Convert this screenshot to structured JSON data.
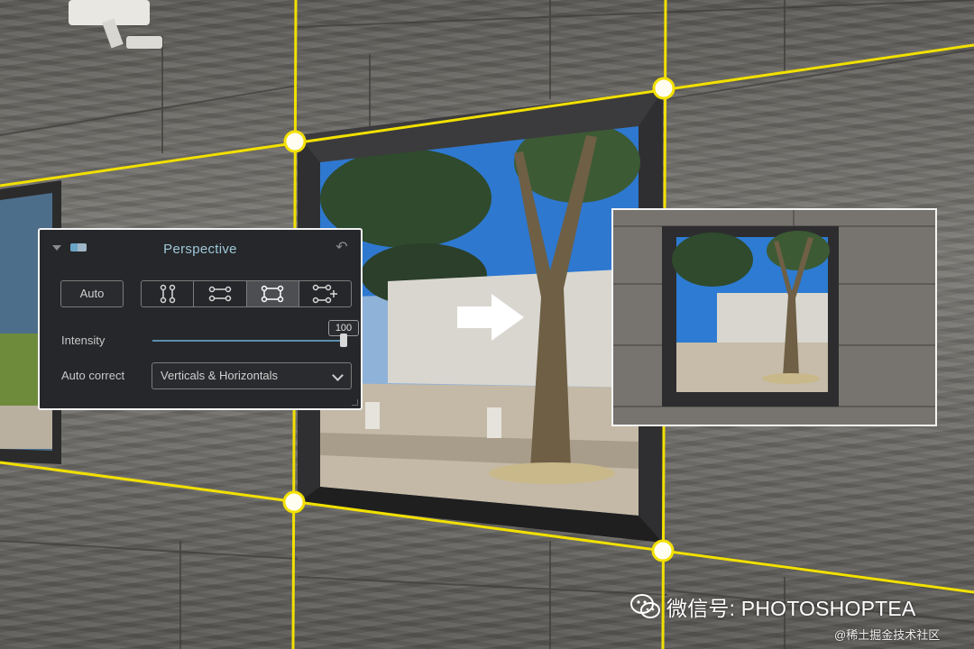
{
  "panel": {
    "title": "Perspective",
    "auto_label": "Auto",
    "intensity_label": "Intensity",
    "intensity_value": "100",
    "auto_correct_label": "Auto correct",
    "auto_correct_selected": "Verticals & Horizontals",
    "modes": [
      {
        "name": "vertical-guides-icon",
        "active": false
      },
      {
        "name": "horizontal-guides-icon",
        "active": false
      },
      {
        "name": "rectangle-guides-icon",
        "active": true
      },
      {
        "name": "custom-guides-icon",
        "active": false
      }
    ]
  },
  "watermark": {
    "text": "微信号: PHOTOSHOPTEA",
    "site": "@稀土掘金技术社区"
  },
  "colors": {
    "guide": "#f2e000",
    "panel_bg": "#26272a",
    "title": "#9ec8d8",
    "slider": "#5b8fae"
  }
}
